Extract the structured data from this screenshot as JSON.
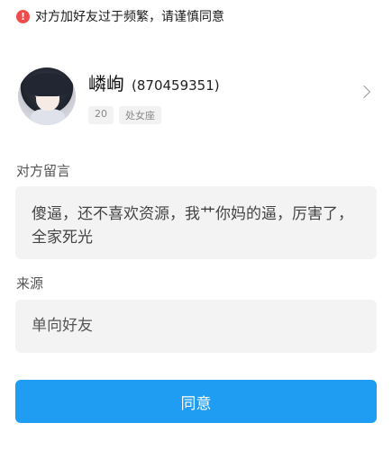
{
  "warning": {
    "text": "对方加好友过于频繁，请谨慎同意",
    "icon": "exclamation-icon",
    "icon_glyph": "!"
  },
  "profile": {
    "nickname": "嶙峋",
    "qq_number": "(870459351)",
    "tags": [
      "20",
      "处女座"
    ]
  },
  "message_section": {
    "label": "对方留言",
    "text": "傻逼，还不喜欢资源，我艹你妈的逼，厉害了，全家死光"
  },
  "source_section": {
    "label": "来源",
    "value": "单向好友"
  },
  "actions": {
    "agree_label": "同意"
  },
  "colors": {
    "accent": "#1e9df2",
    "warning": "#f04b4b"
  }
}
